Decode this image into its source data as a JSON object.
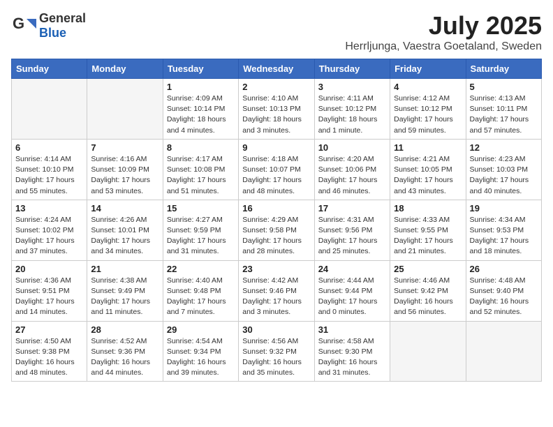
{
  "header": {
    "logo_general": "General",
    "logo_blue": "Blue",
    "month": "July 2025",
    "location": "Herrljunga, Vaestra Goetaland, Sweden"
  },
  "weekdays": [
    "Sunday",
    "Monday",
    "Tuesday",
    "Wednesday",
    "Thursday",
    "Friday",
    "Saturday"
  ],
  "weeks": [
    [
      {
        "num": "",
        "info": ""
      },
      {
        "num": "",
        "info": ""
      },
      {
        "num": "1",
        "info": "Sunrise: 4:09 AM\nSunset: 10:14 PM\nDaylight: 18 hours\nand 4 minutes."
      },
      {
        "num": "2",
        "info": "Sunrise: 4:10 AM\nSunset: 10:13 PM\nDaylight: 18 hours\nand 3 minutes."
      },
      {
        "num": "3",
        "info": "Sunrise: 4:11 AM\nSunset: 10:12 PM\nDaylight: 18 hours\nand 1 minute."
      },
      {
        "num": "4",
        "info": "Sunrise: 4:12 AM\nSunset: 10:12 PM\nDaylight: 17 hours\nand 59 minutes."
      },
      {
        "num": "5",
        "info": "Sunrise: 4:13 AM\nSunset: 10:11 PM\nDaylight: 17 hours\nand 57 minutes."
      }
    ],
    [
      {
        "num": "6",
        "info": "Sunrise: 4:14 AM\nSunset: 10:10 PM\nDaylight: 17 hours\nand 55 minutes."
      },
      {
        "num": "7",
        "info": "Sunrise: 4:16 AM\nSunset: 10:09 PM\nDaylight: 17 hours\nand 53 minutes."
      },
      {
        "num": "8",
        "info": "Sunrise: 4:17 AM\nSunset: 10:08 PM\nDaylight: 17 hours\nand 51 minutes."
      },
      {
        "num": "9",
        "info": "Sunrise: 4:18 AM\nSunset: 10:07 PM\nDaylight: 17 hours\nand 48 minutes."
      },
      {
        "num": "10",
        "info": "Sunrise: 4:20 AM\nSunset: 10:06 PM\nDaylight: 17 hours\nand 46 minutes."
      },
      {
        "num": "11",
        "info": "Sunrise: 4:21 AM\nSunset: 10:05 PM\nDaylight: 17 hours\nand 43 minutes."
      },
      {
        "num": "12",
        "info": "Sunrise: 4:23 AM\nSunset: 10:03 PM\nDaylight: 17 hours\nand 40 minutes."
      }
    ],
    [
      {
        "num": "13",
        "info": "Sunrise: 4:24 AM\nSunset: 10:02 PM\nDaylight: 17 hours\nand 37 minutes."
      },
      {
        "num": "14",
        "info": "Sunrise: 4:26 AM\nSunset: 10:01 PM\nDaylight: 17 hours\nand 34 minutes."
      },
      {
        "num": "15",
        "info": "Sunrise: 4:27 AM\nSunset: 9:59 PM\nDaylight: 17 hours\nand 31 minutes."
      },
      {
        "num": "16",
        "info": "Sunrise: 4:29 AM\nSunset: 9:58 PM\nDaylight: 17 hours\nand 28 minutes."
      },
      {
        "num": "17",
        "info": "Sunrise: 4:31 AM\nSunset: 9:56 PM\nDaylight: 17 hours\nand 25 minutes."
      },
      {
        "num": "18",
        "info": "Sunrise: 4:33 AM\nSunset: 9:55 PM\nDaylight: 17 hours\nand 21 minutes."
      },
      {
        "num": "19",
        "info": "Sunrise: 4:34 AM\nSunset: 9:53 PM\nDaylight: 17 hours\nand 18 minutes."
      }
    ],
    [
      {
        "num": "20",
        "info": "Sunrise: 4:36 AM\nSunset: 9:51 PM\nDaylight: 17 hours\nand 14 minutes."
      },
      {
        "num": "21",
        "info": "Sunrise: 4:38 AM\nSunset: 9:49 PM\nDaylight: 17 hours\nand 11 minutes."
      },
      {
        "num": "22",
        "info": "Sunrise: 4:40 AM\nSunset: 9:48 PM\nDaylight: 17 hours\nand 7 minutes."
      },
      {
        "num": "23",
        "info": "Sunrise: 4:42 AM\nSunset: 9:46 PM\nDaylight: 17 hours\nand 3 minutes."
      },
      {
        "num": "24",
        "info": "Sunrise: 4:44 AM\nSunset: 9:44 PM\nDaylight: 17 hours\nand 0 minutes."
      },
      {
        "num": "25",
        "info": "Sunrise: 4:46 AM\nSunset: 9:42 PM\nDaylight: 16 hours\nand 56 minutes."
      },
      {
        "num": "26",
        "info": "Sunrise: 4:48 AM\nSunset: 9:40 PM\nDaylight: 16 hours\nand 52 minutes."
      }
    ],
    [
      {
        "num": "27",
        "info": "Sunrise: 4:50 AM\nSunset: 9:38 PM\nDaylight: 16 hours\nand 48 minutes."
      },
      {
        "num": "28",
        "info": "Sunrise: 4:52 AM\nSunset: 9:36 PM\nDaylight: 16 hours\nand 44 minutes."
      },
      {
        "num": "29",
        "info": "Sunrise: 4:54 AM\nSunset: 9:34 PM\nDaylight: 16 hours\nand 39 minutes."
      },
      {
        "num": "30",
        "info": "Sunrise: 4:56 AM\nSunset: 9:32 PM\nDaylight: 16 hours\nand 35 minutes."
      },
      {
        "num": "31",
        "info": "Sunrise: 4:58 AM\nSunset: 9:30 PM\nDaylight: 16 hours\nand 31 minutes."
      },
      {
        "num": "",
        "info": ""
      },
      {
        "num": "",
        "info": ""
      }
    ]
  ]
}
